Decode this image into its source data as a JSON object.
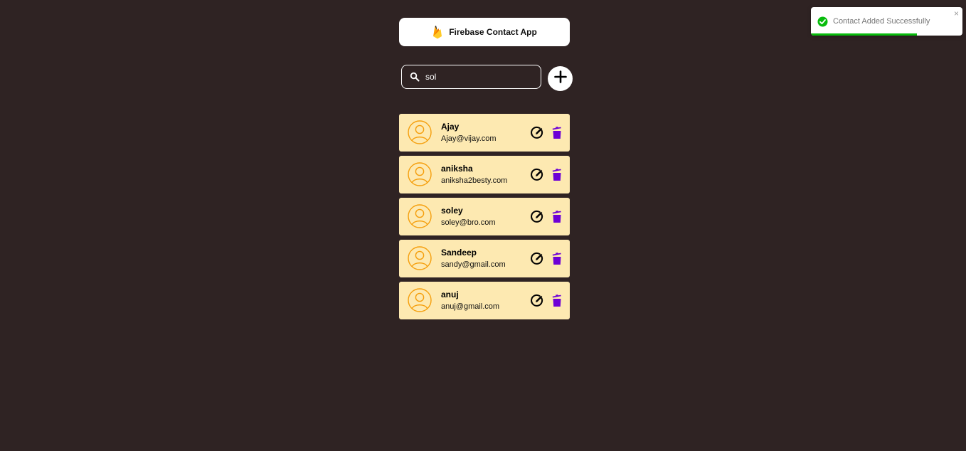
{
  "header": {
    "title": "Firebase Contact App",
    "logo_icon": "firebase-flame-icon"
  },
  "search": {
    "value": "sol",
    "icon": "search-icon"
  },
  "add_button": {
    "icon": "plus-icon"
  },
  "contacts": [
    {
      "name": "Ajay",
      "email": "Ajay@vijay.com"
    },
    {
      "name": "aniksha",
      "email": "aniksha2besty.com"
    },
    {
      "name": "soley",
      "email": "soley@bro.com"
    },
    {
      "name": "Sandeep",
      "email": "sandy@gmail.com"
    },
    {
      "name": "anuj",
      "email": "anuj@gmail.com"
    }
  ],
  "toast": {
    "message": "Contact Added Successfully",
    "close_glyph": "×",
    "icon": "check-circle-icon",
    "progress_fraction": 0.7
  },
  "colors": {
    "background": "#2f2323",
    "card": "#fde9b1",
    "avatar_orange": "#f59e0b",
    "delete_purple": "#6d00d6",
    "success_green": "#07bc0c"
  }
}
